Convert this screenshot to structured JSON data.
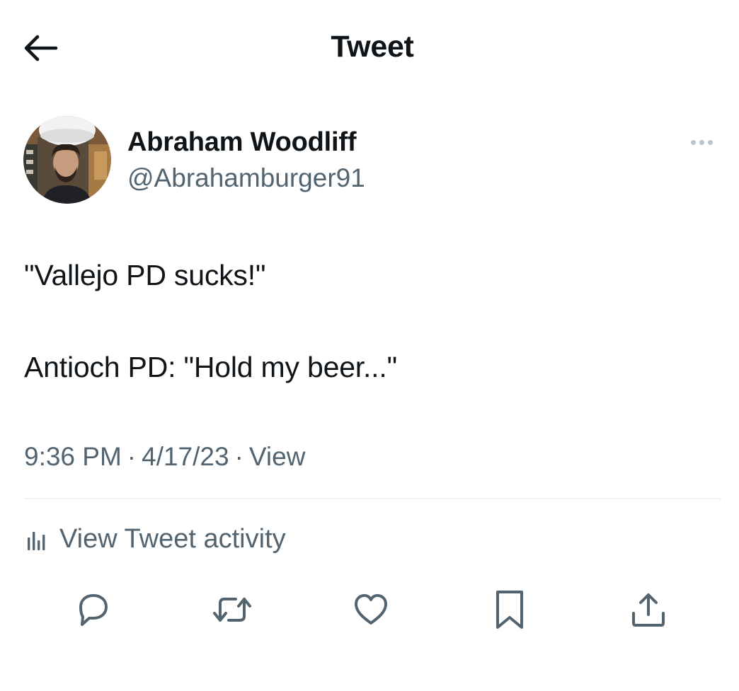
{
  "header": {
    "title": "Tweet",
    "back_icon": "arrow-left-icon"
  },
  "author": {
    "display_name": "Abraham Woodliff",
    "handle": "@Abrahamburger91",
    "avatar": "avatar-photo",
    "more_icon": "more-horizontal-icon"
  },
  "tweet": {
    "lines": [
      "\"Vallejo PD sucks!\"",
      "Antioch PD: \"Hold my beer...\""
    ]
  },
  "meta": {
    "time": "9:36 PM",
    "date": "4/17/23",
    "separator": "·",
    "views_label": "View"
  },
  "activity": {
    "label": "View Tweet activity",
    "icon": "bar-chart-icon"
  },
  "actions": [
    {
      "name": "reply",
      "icon": "reply-icon"
    },
    {
      "name": "retweet",
      "icon": "retweet-icon"
    },
    {
      "name": "like",
      "icon": "heart-icon"
    },
    {
      "name": "bookmark",
      "icon": "bookmark-icon"
    },
    {
      "name": "share",
      "icon": "share-icon"
    }
  ],
  "colors": {
    "text_primary": "#0f1419",
    "text_secondary": "#536471",
    "divider": "#eff3f4",
    "more_dots": "#b9c3cc",
    "background": "#ffffff"
  }
}
